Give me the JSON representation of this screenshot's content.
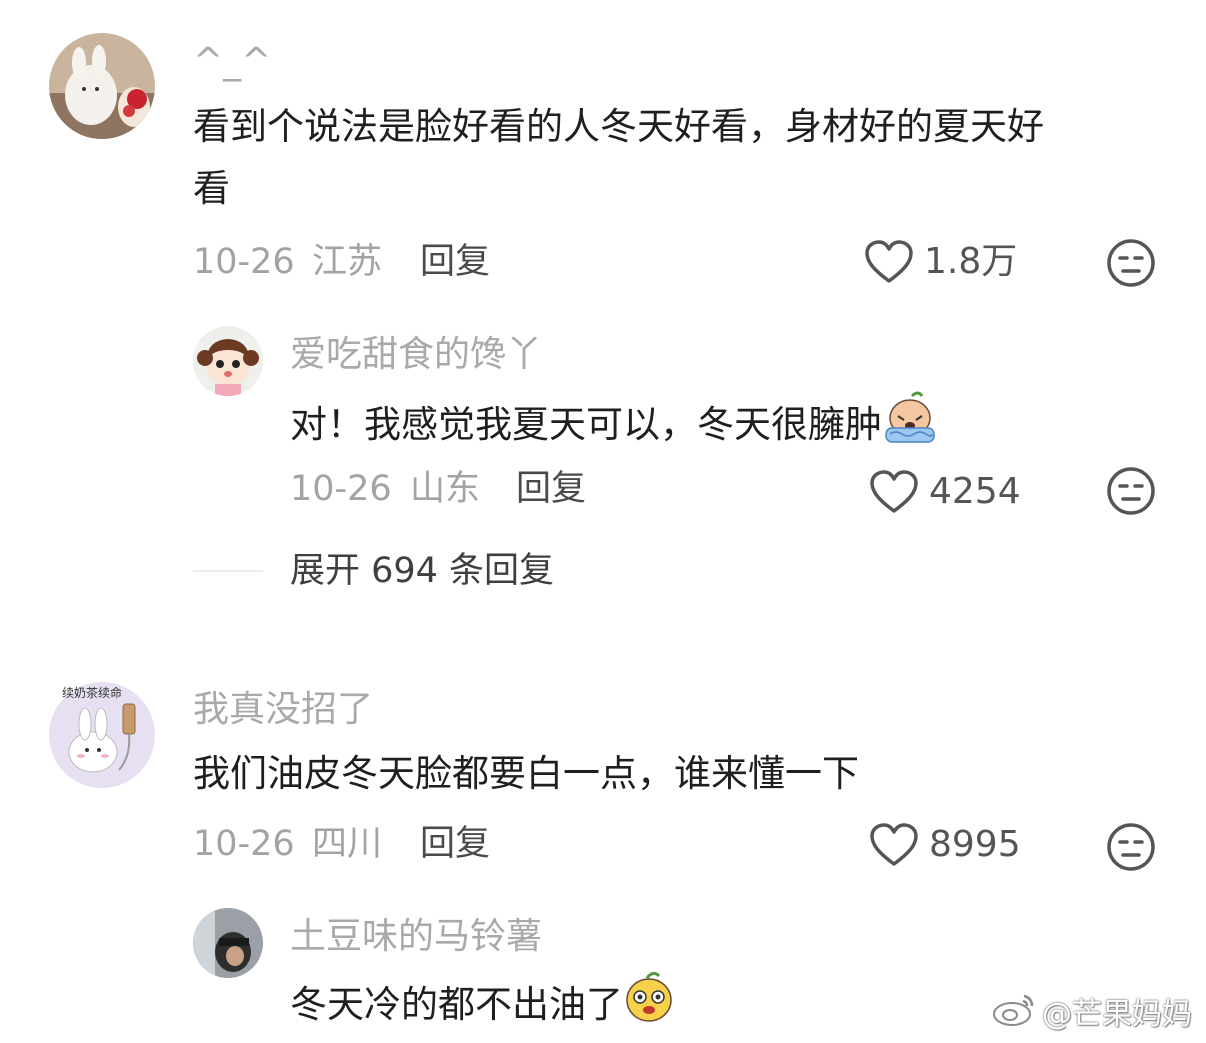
{
  "comments": [
    {
      "username": "^_^",
      "text_line1": "看到个说法是脸好看的人冬天好看，身材好的夏天好",
      "text_line2": "看",
      "date": "10-26",
      "location": "江苏",
      "reply_label": "回复",
      "likes": "1.8万"
    },
    {
      "username": "我真没招了",
      "text_line1": "我们油皮冬天脸都要白一点，谁来懂一下",
      "date": "10-26",
      "location": "四川",
      "reply_label": "回复",
      "likes": "8995",
      "avatar_text": "续奶茶续命"
    }
  ],
  "replies": [
    {
      "username": "爱吃甜食的馋丫",
      "text_line1": "对！我感觉我夏天可以，冬天很臃肿",
      "date": "10-26",
      "location": "山东",
      "reply_label": "回复",
      "likes": "4254"
    },
    {
      "username": "土豆味的马铃薯",
      "text_line1": "冬天冷的都不出油了"
    }
  ],
  "expand": {
    "label": "展开 694 条回复"
  },
  "watermark": {
    "text": "@芒果妈妈"
  },
  "colors": {
    "background": "#ffffff",
    "username": "#a9a9a9",
    "content": "#1f1f1f",
    "meta": "#a3a3a3"
  }
}
